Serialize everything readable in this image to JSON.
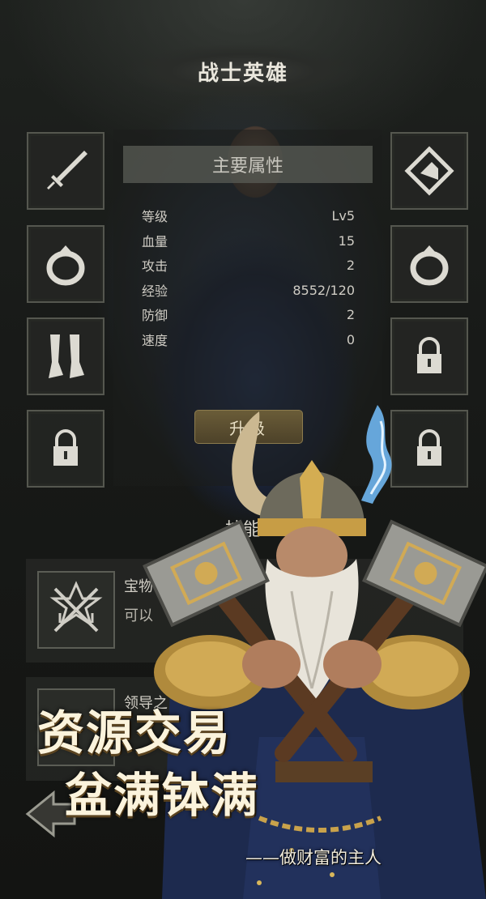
{
  "header": {
    "title": "战士英雄"
  },
  "stats": {
    "header": "主要属性",
    "rows": [
      {
        "label": "等级",
        "value": "Lv5"
      },
      {
        "label": "血量",
        "value": "15"
      },
      {
        "label": "攻击",
        "value": "2"
      },
      {
        "label": "经验",
        "value": "8552/120"
      },
      {
        "label": "防御",
        "value": "2"
      },
      {
        "label": "速度",
        "value": "0"
      }
    ],
    "upgrade_label": "升级"
  },
  "equipment": {
    "left": [
      "sword-icon",
      "ring-icon",
      "boots-icon",
      "lock-icon"
    ],
    "right": [
      "amulet-icon",
      "ring-icon",
      "lock-icon",
      "lock-icon"
    ]
  },
  "skills": {
    "title": "技能",
    "items": [
      {
        "name": "宝物",
        "desc": "可以",
        "icon": "crossed-swords-icon"
      },
      {
        "name": "领导之",
        "desc": "",
        "icon": "skill-icon"
      }
    ]
  },
  "promo": {
    "line1": "资源交易",
    "line2": "盆满钵满",
    "slogan": "——做财富的主人"
  },
  "colors": {
    "background": "#141614",
    "slot_border": "#55574f",
    "button_gold": "#6a5c38",
    "promo_text": "#fbf3dc"
  }
}
